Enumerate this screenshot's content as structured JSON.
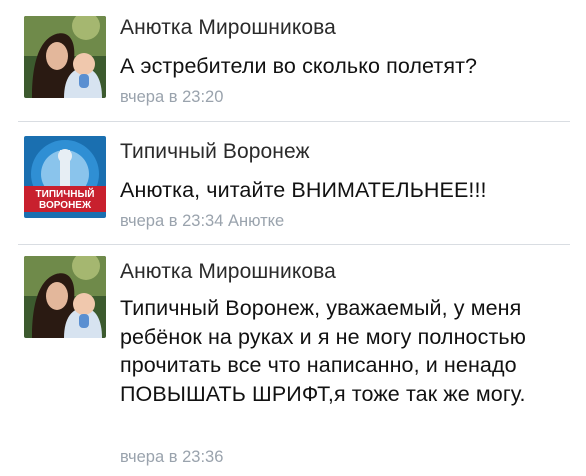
{
  "comments": [
    {
      "author": "Анютка Мирошникова",
      "text": "А эстребители во сколько полетят?",
      "time": "вчера в 23:20",
      "reply_to": ""
    },
    {
      "author": "Типичный Воронеж",
      "text": "Анютка, читайте ВНИМАТЕЛЬНЕЕ!!!",
      "time": "вчера в 23:34",
      "reply_to": "Анютке",
      "avatar_label_line1": "ТИПИЧНЫЙ",
      "avatar_label_line2": "ВОРОНЕЖ"
    },
    {
      "author": "Анютка Мирошникова",
      "text": "Типичный Воронеж, уважаемый, у меня ребёнок на руках и я не могу полностью прочитать все что написанно, и ненадо ПОВЫШАТЬ ШРИФТ,я тоже так же могу.",
      "time": "вчера в 23:36",
      "reply_to": ""
    }
  ],
  "colors": {
    "author": "#2a2a2a",
    "text": "#111111",
    "meta": "#9aa3ad",
    "divider": "#d9dde2",
    "community_badge": "#c8202e"
  }
}
